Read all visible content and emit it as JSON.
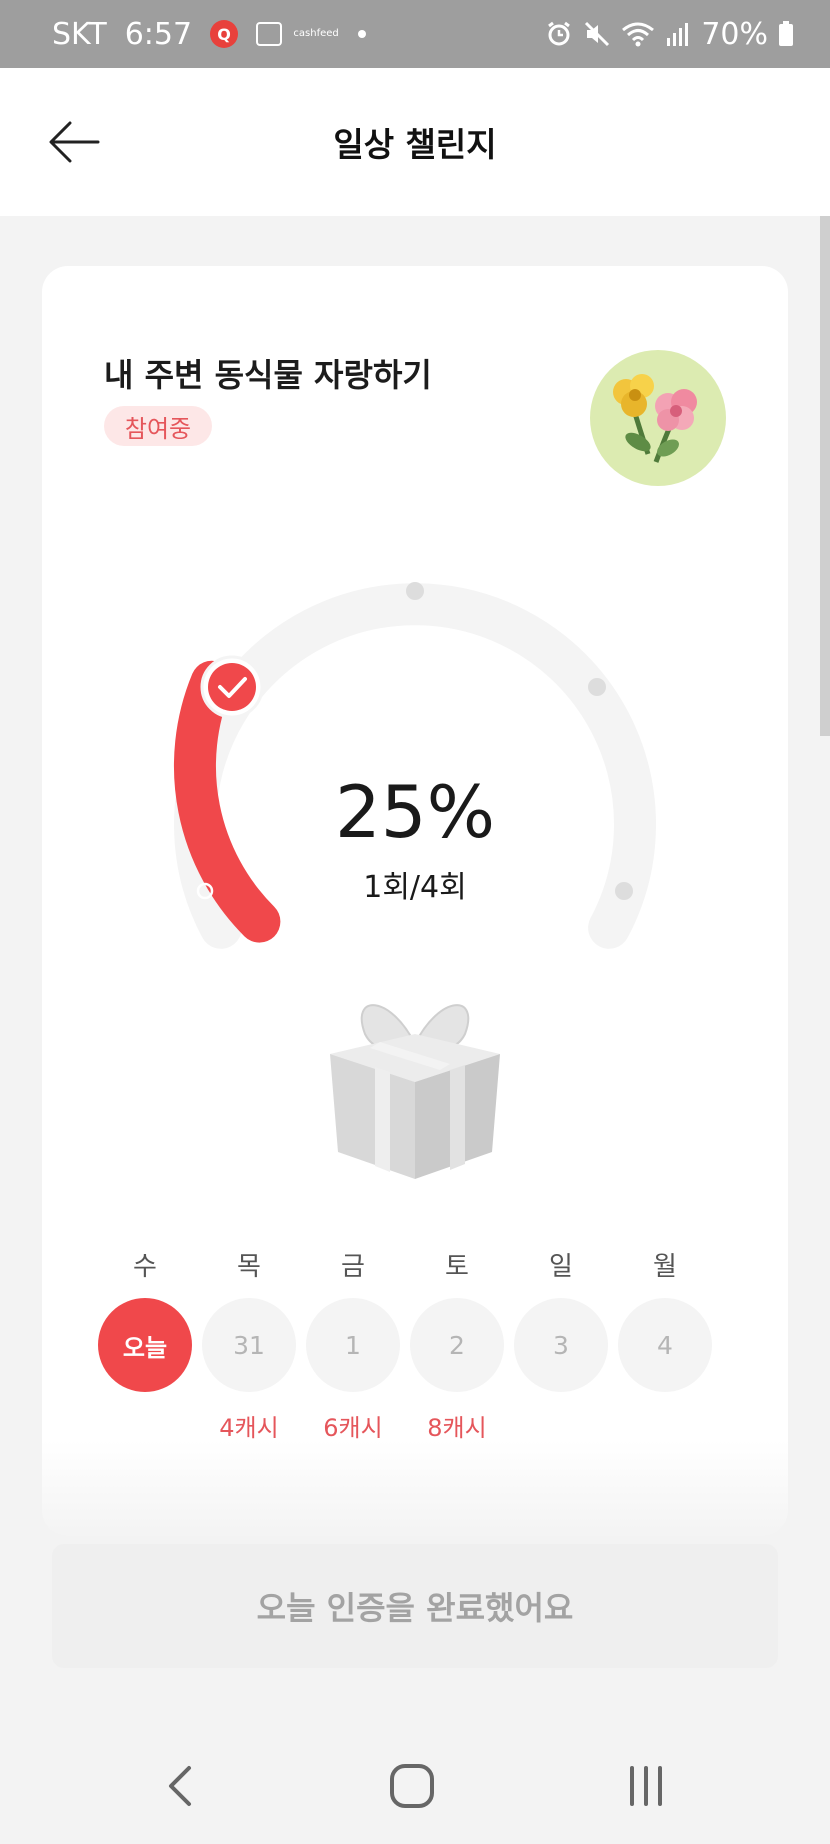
{
  "status_bar": {
    "carrier": "SKT",
    "time": "6:57",
    "app_badge": "Q",
    "cash_feed_line1": "cash",
    "cash_feed_line2": "feed",
    "battery": "70%"
  },
  "header": {
    "title": "일상 챌린지"
  },
  "challenge": {
    "title": "내 주변 동식물 자랑하기",
    "status": "참여중"
  },
  "progress": {
    "percent_text": "25%",
    "count_text": "1회/4회",
    "value": 0.25
  },
  "days": [
    {
      "label": "수",
      "date": "오늘",
      "reward": "",
      "today": true
    },
    {
      "label": "목",
      "date": "31",
      "reward": "4캐시",
      "today": false
    },
    {
      "label": "금",
      "date": "1",
      "reward": "6캐시",
      "today": false
    },
    {
      "label": "토",
      "date": "2",
      "reward": "8캐시",
      "today": false
    },
    {
      "label": "일",
      "date": "3",
      "reward": "",
      "today": false
    },
    {
      "label": "월",
      "date": "4",
      "reward": "",
      "today": false
    }
  ],
  "cta": {
    "label": "오늘 인증을 완료했어요"
  },
  "colors": {
    "accent": "#f0484b",
    "pill_bg": "#fde7e7",
    "reward_text": "#e5565b"
  },
  "icons": [
    "back-arrow-icon",
    "check-icon",
    "flower-icon",
    "gift-icon",
    "alarm-icon",
    "mute-icon",
    "wifi-icon",
    "signal-icon",
    "battery-icon",
    "nav-back-icon",
    "nav-home-icon",
    "nav-recents-icon"
  ]
}
